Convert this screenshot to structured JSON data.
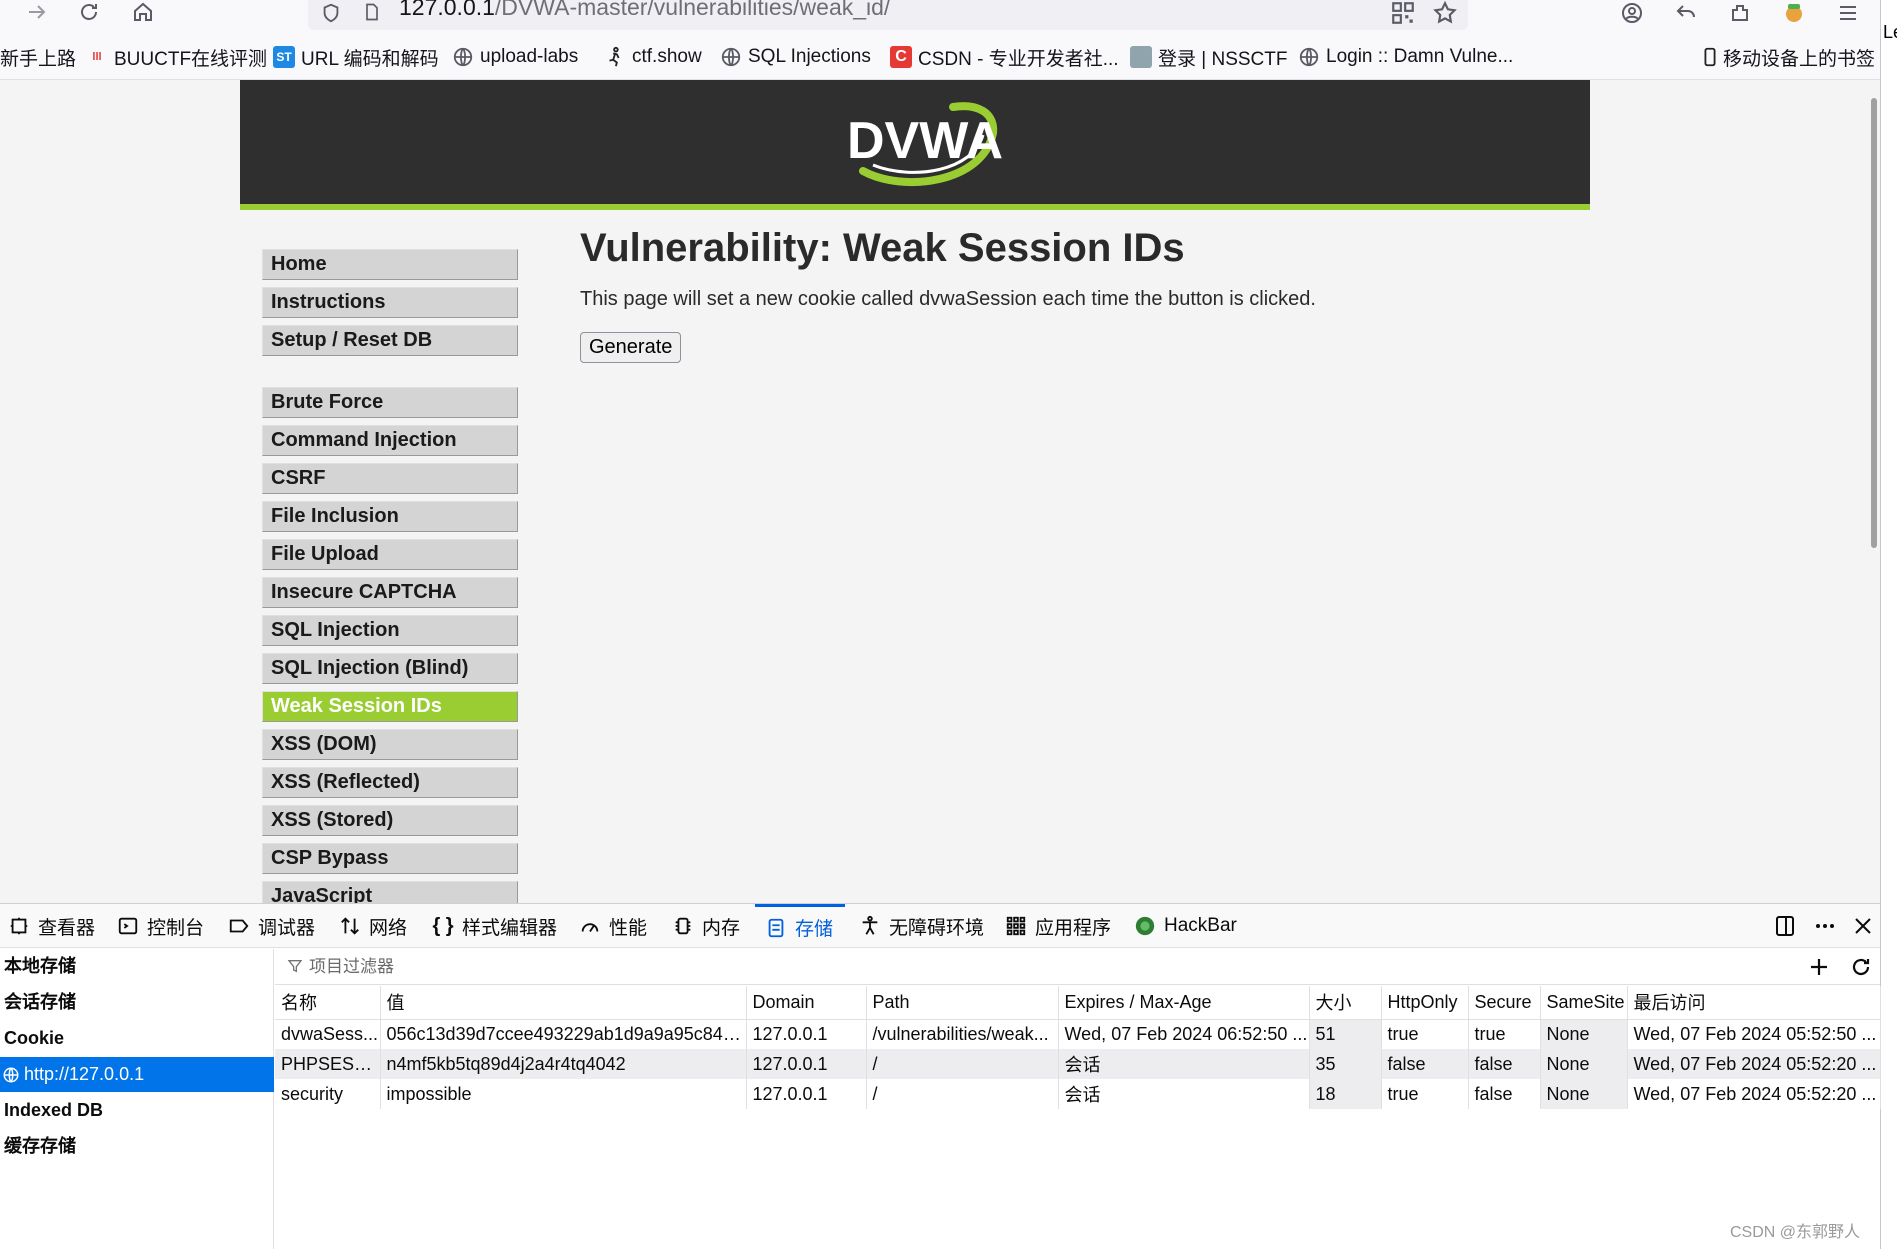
{
  "browser": {
    "url_host": "127.0.0.1",
    "url_path": "/DVWA-master/vulnerabilities/weak_id/",
    "right_edge_text": "Le"
  },
  "bookmarks": [
    {
      "label": "新手上路",
      "icon": "none"
    },
    {
      "label": "BUUCTF在线评测",
      "icon": "buuctf-icon",
      "color": "#e53935"
    },
    {
      "label": "URL 编码和解码",
      "icon": "st-icon",
      "color": "#1e88e5",
      "badge": "ST"
    },
    {
      "label": "upload-labs",
      "icon": "globe-icon"
    },
    {
      "label": "ctf.show",
      "icon": "runner-icon"
    },
    {
      "label": "SQL Injections",
      "icon": "globe-icon"
    },
    {
      "label": "CSDN - 专业开发者社...",
      "icon": "csdn-icon",
      "color": "#e53935",
      "badge": "C"
    },
    {
      "label": "登录 | NSSCTF",
      "icon": "nssctf-icon"
    },
    {
      "label": "Login :: Damn Vulne...",
      "icon": "globe-icon"
    },
    {
      "label": "移动设备上的书签",
      "icon": "mobile-icon"
    }
  ],
  "page": {
    "logo_text": "DVWA",
    "title": "Vulnerability: Weak Session IDs",
    "description": "This page will set a new cookie called dvwaSession each time the button is clicked.",
    "button_label": "Generate",
    "accent": "#9acd32",
    "menu": [
      {
        "label": "Home"
      },
      {
        "label": "Instructions"
      },
      {
        "label": "Setup / Reset DB"
      },
      {
        "label": "Brute Force"
      },
      {
        "label": "Command Injection"
      },
      {
        "label": "CSRF"
      },
      {
        "label": "File Inclusion"
      },
      {
        "label": "File Upload"
      },
      {
        "label": "Insecure CAPTCHA"
      },
      {
        "label": "SQL Injection"
      },
      {
        "label": "SQL Injection (Blind)"
      },
      {
        "label": "Weak Session IDs",
        "active": true
      },
      {
        "label": "XSS (DOM)"
      },
      {
        "label": "XSS (Reflected)"
      },
      {
        "label": "XSS (Stored)"
      },
      {
        "label": "CSP Bypass"
      },
      {
        "label": "JavaScript"
      }
    ]
  },
  "devtools": {
    "tabs": [
      {
        "label": "查看器",
        "icon": "inspector-icon"
      },
      {
        "label": "控制台",
        "icon": "console-icon"
      },
      {
        "label": "调试器",
        "icon": "debugger-icon"
      },
      {
        "label": "网络",
        "icon": "network-icon"
      },
      {
        "label": "样式编辑器",
        "icon": "style-editor-icon"
      },
      {
        "label": "性能",
        "icon": "performance-icon"
      },
      {
        "label": "内存",
        "icon": "memory-icon"
      },
      {
        "label": "存储",
        "icon": "storage-icon",
        "selected": true
      },
      {
        "label": "无障碍环境",
        "icon": "accessibility-icon"
      },
      {
        "label": "应用程序",
        "icon": "application-icon"
      },
      {
        "label": "HackBar",
        "icon": "hackbar-icon"
      }
    ],
    "sidebar": [
      {
        "label": "本地存储"
      },
      {
        "label": "会话存储"
      },
      {
        "label": "Cookie"
      },
      {
        "label": "http://127.0.0.1",
        "selected": true
      },
      {
        "label": "Indexed DB"
      },
      {
        "label": "缓存存储"
      }
    ],
    "filter_placeholder": "项目过滤器",
    "columns": [
      "名称",
      "值",
      "Domain",
      "Path",
      "Expires / Max-Age",
      "大小",
      "HttpOnly",
      "Secure",
      "SameSite",
      "最后访问"
    ],
    "rows": [
      [
        "dvwaSess...",
        "056c13d39d7ccee493229ab1d9a9a95c84a...",
        "127.0.0.1",
        "/vulnerabilities/weak...",
        "Wed, 07 Feb 2024 06:52:50 ...",
        "51",
        "true",
        "true",
        "None",
        "Wed, 07 Feb 2024 05:52:50 ..."
      ],
      [
        "PHPSESSID",
        "n4mf5kb5tq89d4j2a4r4tq4042",
        "127.0.0.1",
        "/",
        "会话",
        "35",
        "false",
        "false",
        "None",
        "Wed, 07 Feb 2024 05:52:20 ..."
      ],
      [
        "security",
        "impossible",
        "127.0.0.1",
        "/",
        "会话",
        "18",
        "true",
        "false",
        "None",
        "Wed, 07 Feb 2024 05:52:20 ..."
      ]
    ]
  },
  "watermark": "CSDN @东郭野人"
}
